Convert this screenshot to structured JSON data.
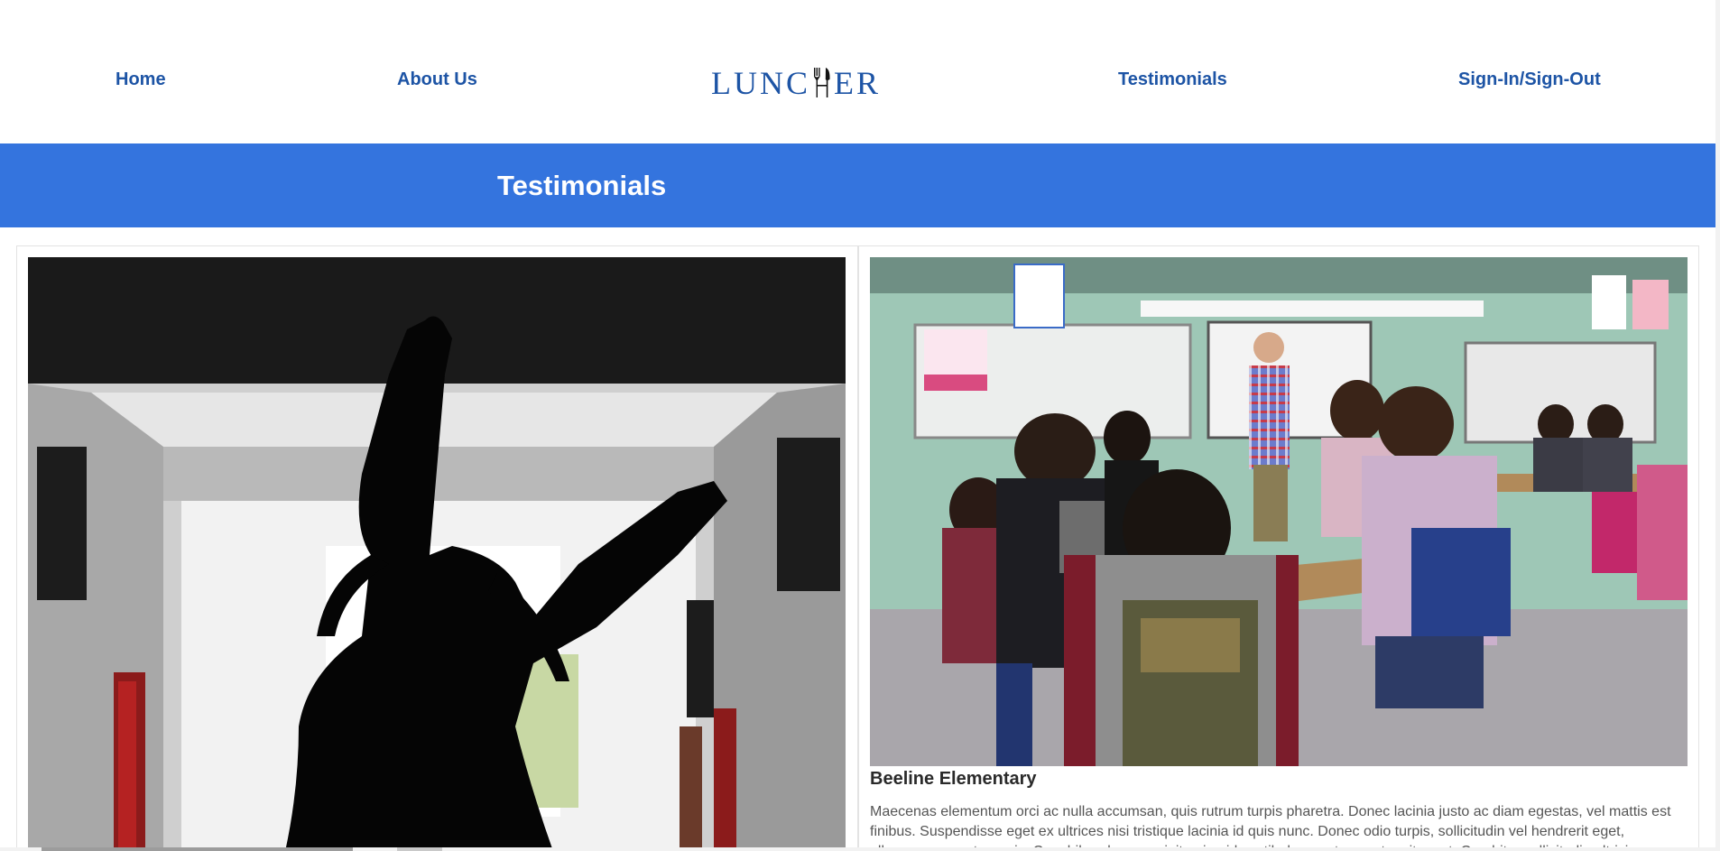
{
  "nav": {
    "home": "Home",
    "about": "About Us",
    "testimonials": "Testimonials",
    "signin": "Sign-In/Sign-Out",
    "logo_left": "LUNC",
    "logo_right": "ER"
  },
  "banner": {
    "title": "Testimonials"
  },
  "cards": [
    {
      "photo": "silhouette-girl-hallway-photo",
      "title": "",
      "text": ""
    },
    {
      "photo": "classroom-students-photo",
      "title": "Beeline Elementary",
      "text": "Maecenas elementum orci ac nulla accumsan, quis rutrum turpis pharetra. Donec lacinia justo ac diam egestas, vel mattis est finibus. Suspendisse eget ex ultrices nisi tristique lacinia id quis nunc. Donec odio turpis, sollicitudin vel hendrerit eget, ullamcorper eget mauris. Cras bibendum suscipit enim, id vestibulum metus auctor sit amet. Curabitur sollicitudin ultricies"
    }
  ],
  "colors": {
    "nav_link": "#1d54a5",
    "banner": "#3474de"
  }
}
